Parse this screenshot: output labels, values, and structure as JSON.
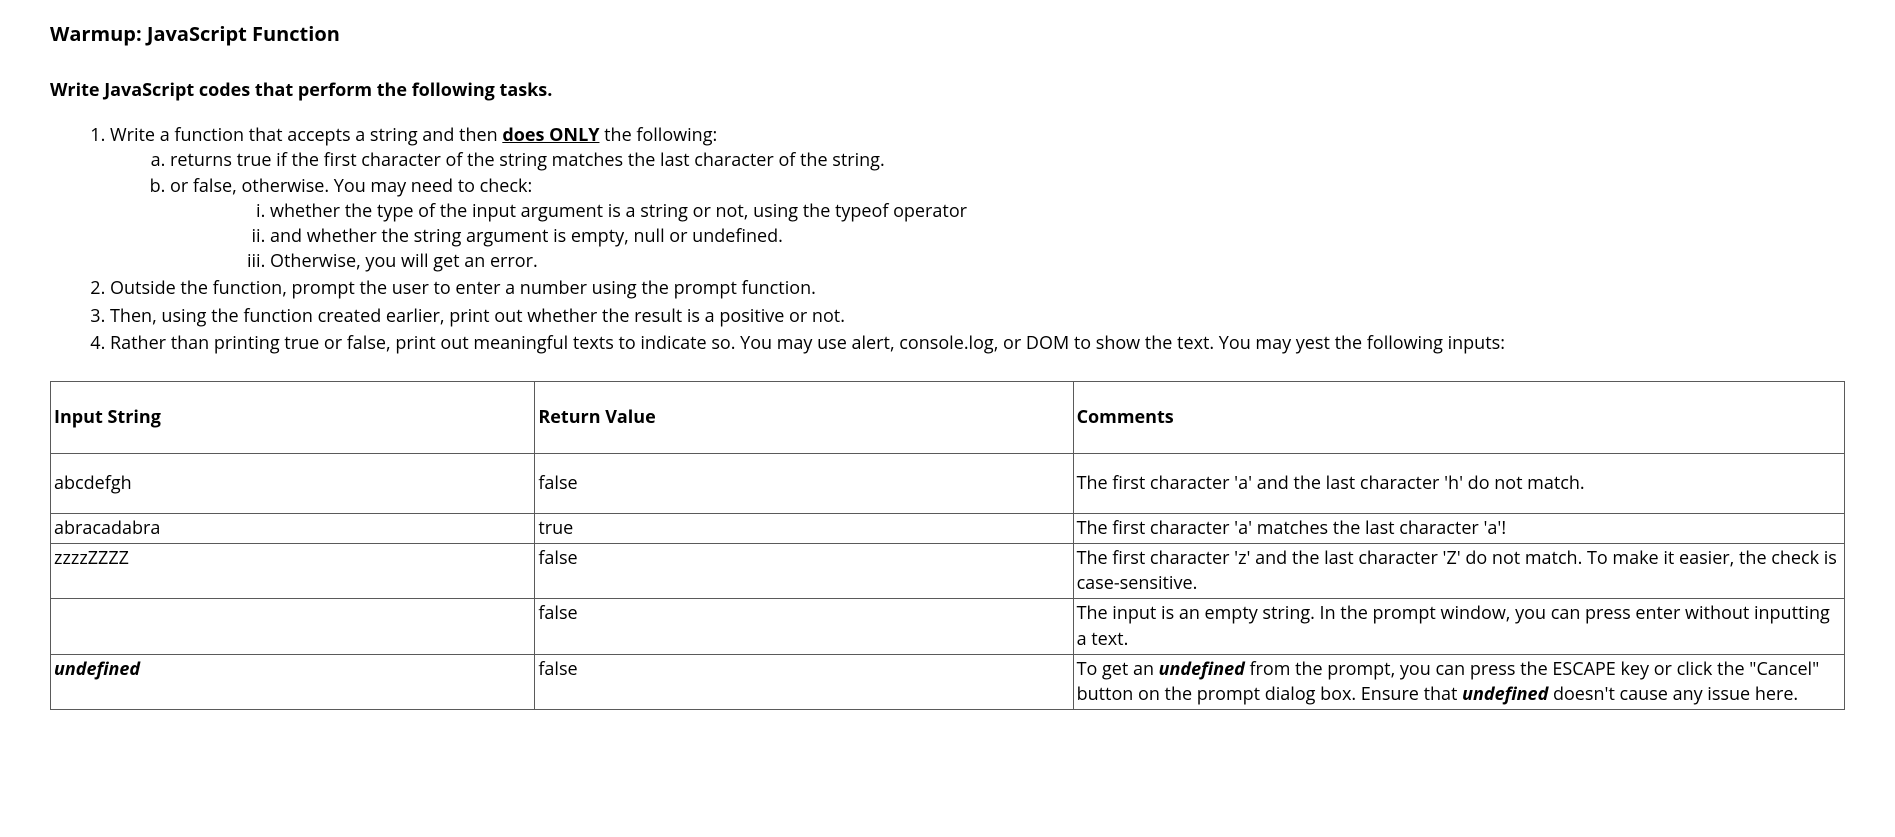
{
  "page_title": "Warmup: JavaScript Function",
  "instruction": "Write JavaScript codes that perform the following tasks.",
  "item1_pre": "Write a function that accepts a string and then ",
  "item1_bold": "does ONLY",
  "item1_post": " the following:",
  "item1a": "returns true if the first character of the string matches the last character of the string.",
  "item1b": "or false, otherwise. You may need to check:",
  "item1b_i": "whether the type of the input argument is a string or not, using the typeof operator",
  "item1b_ii": "and whether the string argument is empty, null or undefined.",
  "item1b_iii": "Otherwise, you will get an error.",
  "item2": "Outside the function, prompt the user to enter a number using the prompt function.",
  "item3": "Then, using the function created earlier, print out whether the result is a positive or not.",
  "item4": "Rather than printing true or false, print out meaningful texts to indicate so. You may use alert, console.log, or DOM to show the text. You may yest the following inputs:",
  "table": {
    "headers": {
      "c1": "Input String",
      "c2": "Return Value",
      "c3": "Comments"
    },
    "rows": [
      {
        "input": "abcdefgh",
        "input_style": "plain",
        "ret": "false",
        "comment_parts": [
          {
            "t": "The first character 'a' and the last character 'h' do not match.",
            "s": "plain"
          }
        ]
      },
      {
        "input": "abracadabra",
        "input_style": "plain",
        "ret": "true",
        "comment_parts": [
          {
            "t": "The first character 'a' matches the last character 'a'!",
            "s": "plain"
          }
        ]
      },
      {
        "input": "zzzzZZZZ",
        "input_style": "plain",
        "ret": "false",
        "comment_parts": [
          {
            "t": "The first character 'z' and the last character 'Z' do not match. To make it easier, the check is case-sensitive.",
            "s": "plain"
          }
        ]
      },
      {
        "input": "",
        "input_style": "plain",
        "ret": "false",
        "comment_parts": [
          {
            "t": "The input is an empty string. In the prompt window, you can press enter without inputting a text.",
            "s": "plain"
          }
        ]
      },
      {
        "input": "undefined",
        "input_style": "bi",
        "ret": "false",
        "comment_parts": [
          {
            "t": "To get an ",
            "s": "plain"
          },
          {
            "t": "undefined",
            "s": "bi"
          },
          {
            "t": " from the prompt, you can press the ESCAPE key or click the \"Cancel\" button on the prompt dialog box. Ensure that ",
            "s": "plain"
          },
          {
            "t": "undefined",
            "s": "bi"
          },
          {
            "t": " doesn't cause any issue here.",
            "s": "plain"
          }
        ]
      }
    ]
  }
}
